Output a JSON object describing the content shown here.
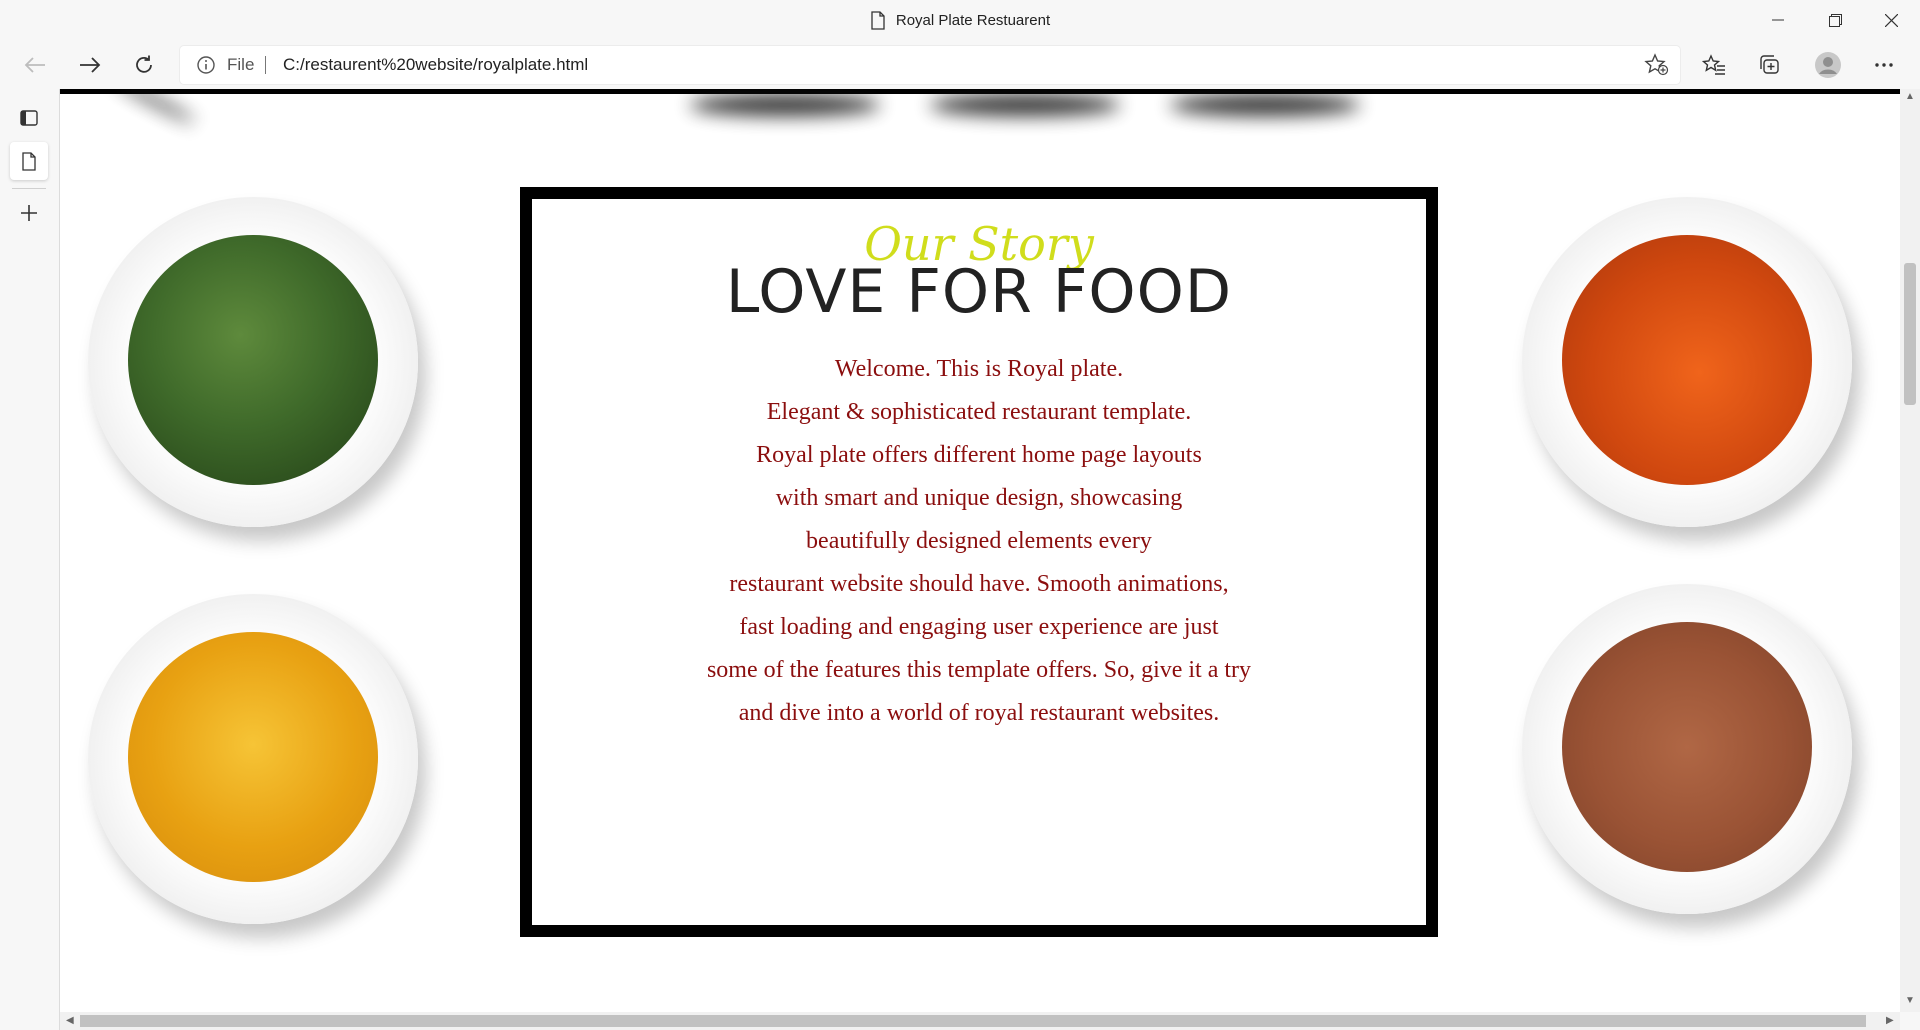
{
  "window": {
    "title": "Royal Plate Restuarent"
  },
  "toolbar": {
    "back_icon": "arrow-left-icon",
    "forward_icon": "arrow-right-icon",
    "refresh_icon": "refresh-icon",
    "protocol_label": "File",
    "url": "C:/restaurent%20website/royalplate.html"
  },
  "sidebar": {
    "items": [
      {
        "name": "tab-actions-icon"
      },
      {
        "name": "page-tab-icon"
      },
      {
        "name": "new-tab-icon"
      }
    ]
  },
  "content": {
    "kicker": "Our Story",
    "headline": "LOVE FOR FOOD",
    "paragraph_lines": [
      "Welcome. This is Royal plate.",
      "Elegant & sophisticated restaurant template.",
      "Royal plate offers different home page layouts",
      "with smart and unique design, showcasing",
      "beautifully designed elements every",
      "restaurant website should have. Smooth animations,",
      "fast loading and engaging user experience are just",
      "some of the features this template offers. So, give it a try",
      "and dive into a world of royal restaurant websites."
    ],
    "spices": [
      {
        "name": "green-herbs-bowl",
        "color": "#3f6a2a"
      },
      {
        "name": "chili-powder-bowl",
        "color": "#d0480f"
      },
      {
        "name": "turmeric-bowl",
        "color": "#e8a112"
      },
      {
        "name": "cumin-powder-bowl",
        "color": "#9a5335"
      }
    ]
  },
  "colors": {
    "kicker": "#d0dd1c",
    "paragraph": "#8b0e0e",
    "headline": "#222222",
    "frame": "#000000"
  }
}
